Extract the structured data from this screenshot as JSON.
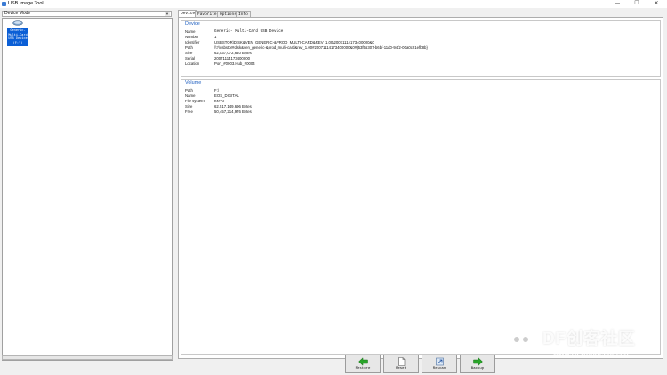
{
  "window": {
    "title": "USB Image Tool",
    "minimize": "—",
    "maximize": "☐",
    "close": "✕"
  },
  "left": {
    "mode_select": "Device Mode",
    "device": {
      "label_lines": [
        "Generic-",
        "Multi-Card",
        "USB Device",
        "(F:\\)"
      ]
    }
  },
  "tabs": [
    {
      "label": "Device"
    },
    {
      "label": "Favorites"
    },
    {
      "label": "Options"
    },
    {
      "label": "Info"
    }
  ],
  "device_group": {
    "title": "Device",
    "rows": [
      {
        "key": "Name",
        "value": "Generic- Multi-Card USB Device"
      },
      {
        "key": "Number",
        "value": "1"
      },
      {
        "key": "Identifier",
        "value": "USBSTOR\\DISK&VEN_GENERIC-&PROD_MULTI-CARD&REV_1.00\\20071114173400000&0"
      },
      {
        "key": "Path",
        "value": "\\\\?\\usbstor#disk&ven_generic-&prod_multi-card&rev_1.00#20071114173400000&0#{53f56307-b6bf-11d0-94f2-00a0c91efb8b}"
      },
      {
        "key": "Size",
        "value": "62,537,072,640 Bytes"
      },
      {
        "key": "Serial",
        "value": "20071114173400000"
      },
      {
        "key": "Location",
        "value": "Port_#0003.Hub_#0004"
      }
    ]
  },
  "volume_group": {
    "title": "Volume",
    "rows": [
      {
        "key": "Path",
        "value": "F:\\"
      },
      {
        "key": "Name",
        "value": "EOS_DIGITAL"
      },
      {
        "key": "File system",
        "value": "exFAT"
      },
      {
        "key": "Size",
        "value": "62,517,149,696 Bytes"
      },
      {
        "key": "Free",
        "value": "50,457,214,976 Bytes"
      }
    ]
  },
  "buttons": {
    "restore": "Restore",
    "reset": "Reset",
    "rescan": "Rescan",
    "backup": "Backup"
  },
  "watermark": {
    "big": "DF创客社区",
    "small": "www.DFRobot.com.cn"
  },
  "colors": {
    "selection": "#0b5fd6",
    "group_title": "#2060c0",
    "arrow_green": "#2aa52a"
  }
}
